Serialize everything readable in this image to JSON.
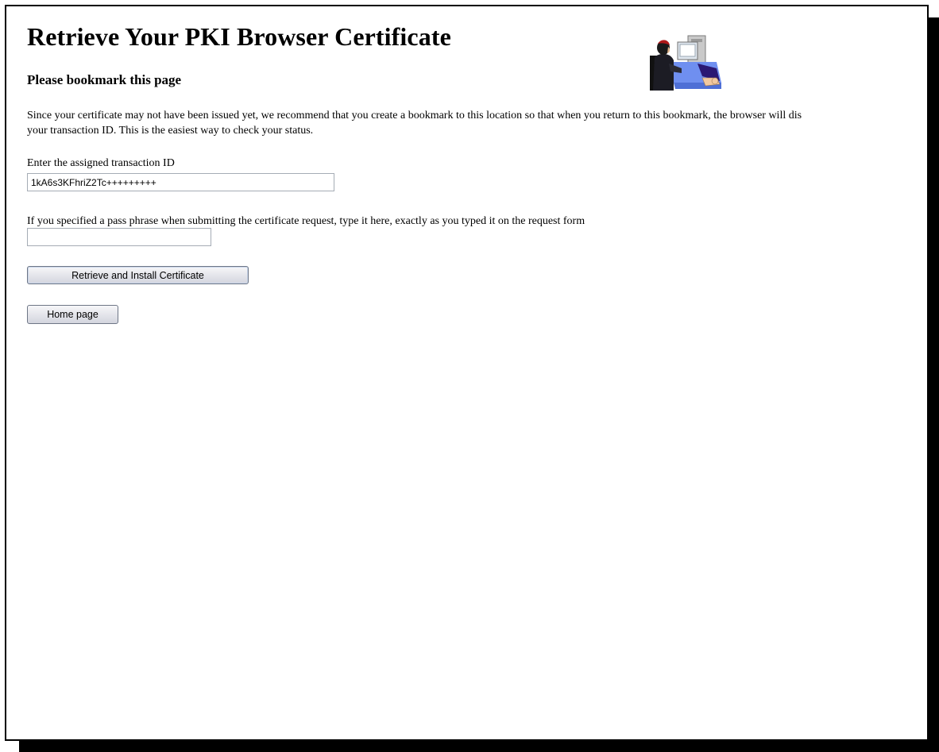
{
  "page": {
    "title": "Retrieve Your PKI Browser Certificate",
    "subtitle": "Please bookmark this page",
    "intro_line1": "Since your certificate may not have been issued yet, we recommend that you create a bookmark to this location so that when you return to this bookmark, the browser will dis",
    "intro_line2": "your transaction ID. This is the easiest way to check your status.",
    "illustration_icon": "person-at-computer-icon"
  },
  "form": {
    "transaction_label": "Enter the assigned transaction ID",
    "transaction_value": "1kA6s3KFhriZ2Tc+++++++++",
    "passphrase_label": "If you specified a pass phrase when submitting the certificate request, type it here, exactly as you typed it on the request form",
    "passphrase_value": "",
    "retrieve_button": "Retrieve and Install Certificate",
    "home_button": "Home page"
  },
  "colors": {
    "button_focus_border": "#2d5a9a",
    "illustration_blue": "#6f8ff0",
    "illustration_purple": "#2b1873"
  }
}
